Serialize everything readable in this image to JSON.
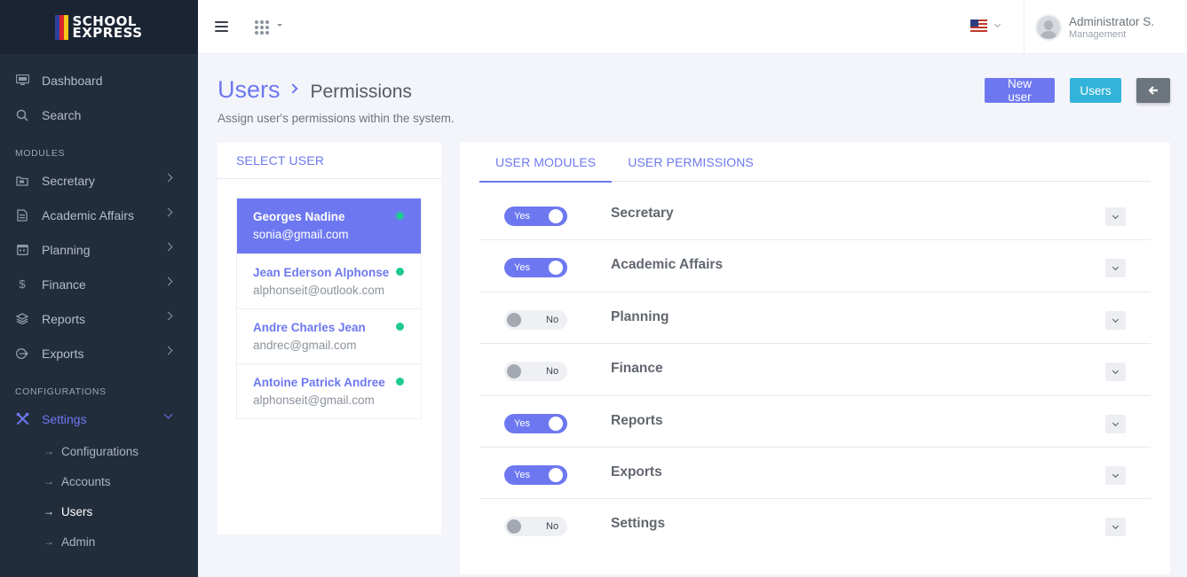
{
  "brand": {
    "line1": "SCHOOL",
    "line2": "EXPRESS"
  },
  "sidebar": {
    "top_items": [
      {
        "label": "Dashboard",
        "icon": "monitor-icon"
      },
      {
        "label": "Search",
        "icon": "search-icon"
      }
    ],
    "modules_label": "MODULES",
    "module_items": [
      {
        "label": "Secretary",
        "icon": "folder-icon"
      },
      {
        "label": "Academic Affairs",
        "icon": "document-icon"
      },
      {
        "label": "Planning",
        "icon": "calendar-icon"
      },
      {
        "label": "Finance",
        "icon": "dollar-icon"
      },
      {
        "label": "Reports",
        "icon": "layers-icon"
      },
      {
        "label": "Exports",
        "icon": "export-icon"
      }
    ],
    "configurations_label": "CONFIGURATIONS",
    "settings": {
      "label": "Settings",
      "icon": "tools-icon"
    },
    "settings_sub": [
      "Configurations",
      "Accounts",
      "Users",
      "Admin"
    ],
    "active_sub": "Users"
  },
  "topbar": {
    "user_name": "Administrator S.",
    "user_role": "Management",
    "language_icon": "us-flag-icon"
  },
  "page": {
    "breadcrumb_main": "Users",
    "breadcrumb_sub": "Permissions",
    "description": "Assign user's permissions within the system.",
    "btn_new_user": "New user",
    "btn_users": "Users",
    "btn_back": "🡐"
  },
  "select_user": {
    "title": "SELECT USER",
    "users": [
      {
        "name": "Georges Nadine",
        "email": "sonia@gmail.com",
        "selected": true
      },
      {
        "name": "Jean Ederson Alphonse",
        "email": "alphonseit@outlook.com",
        "selected": false
      },
      {
        "name": "Andre Charles Jean",
        "email": "andrec@gmail.com",
        "selected": false
      },
      {
        "name": "Antoine Patrick Andree",
        "email": "alphonseit@gmail.com",
        "selected": false
      }
    ],
    "status_color": "#1fc995"
  },
  "tabs": {
    "modules": "USER MODULES",
    "permissions": "USER PERMISSIONS"
  },
  "modules": [
    {
      "name": "Secretary",
      "enabled": true,
      "toggle_label": "Yes"
    },
    {
      "name": "Academic Affairs",
      "enabled": true,
      "toggle_label": "Yes"
    },
    {
      "name": "Planning",
      "enabled": false,
      "toggle_label": "No"
    },
    {
      "name": "Finance",
      "enabled": false,
      "toggle_label": "No"
    },
    {
      "name": "Reports",
      "enabled": true,
      "toggle_label": "Yes"
    },
    {
      "name": "Exports",
      "enabled": true,
      "toggle_label": "Yes"
    },
    {
      "name": "Settings",
      "enabled": false,
      "toggle_label": "No"
    }
  ],
  "colors": {
    "accent": "#6d78f0",
    "info": "#32b3d9",
    "sidebar": "#222d3c"
  }
}
